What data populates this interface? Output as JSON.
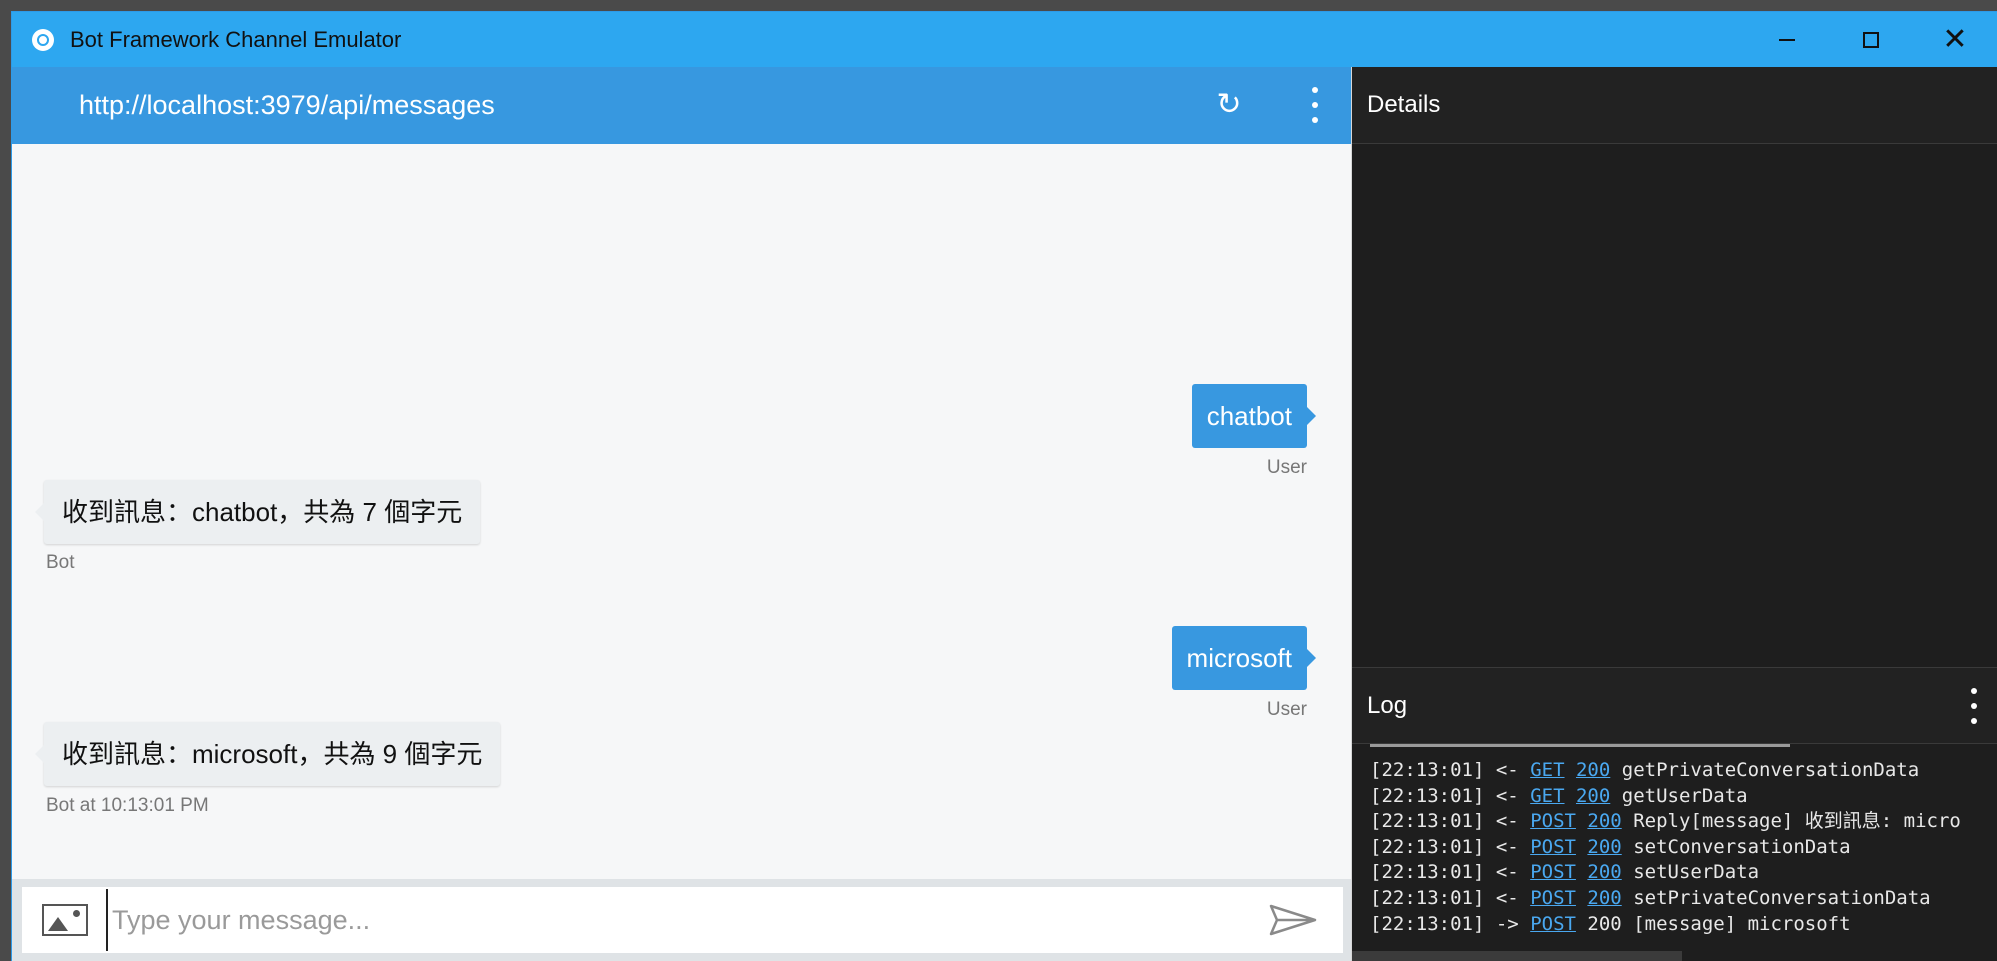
{
  "window": {
    "title": "Bot Framework Channel Emulator"
  },
  "chat": {
    "endpoint_url": "http://localhost:3979/api/messages",
    "messages": [
      {
        "from": "user",
        "text": "chatbot",
        "meta": "User"
      },
      {
        "from": "bot",
        "text": "收到訊息：chatbot，共為 7 個字元",
        "meta": "Bot"
      },
      {
        "from": "user",
        "text": "microsoft",
        "meta": "User"
      },
      {
        "from": "bot",
        "text": "收到訊息：microsoft，共為 9 個字元",
        "meta": "Bot at 10:13:01 PM"
      }
    ],
    "input_placeholder": "Type your message..."
  },
  "details": {
    "title": "Details"
  },
  "log": {
    "title": "Log",
    "lines": [
      {
        "time": "[22:13:01]",
        "dir": "<-",
        "method": "GET",
        "status": "200",
        "text": "getPrivateConversationData",
        "status_link": true
      },
      {
        "time": "[22:13:01]",
        "dir": "<-",
        "method": "GET",
        "status": "200",
        "text": "getUserData",
        "status_link": true
      },
      {
        "time": "[22:13:01]",
        "dir": "<-",
        "method": "POST",
        "status": "200",
        "text": "Reply[message] 收到訊息: micro",
        "status_link": true
      },
      {
        "time": "[22:13:01]",
        "dir": "<-",
        "method": "POST",
        "status": "200",
        "text": "setConversationData",
        "status_link": true
      },
      {
        "time": "[22:13:01]",
        "dir": "<-",
        "method": "POST",
        "status": "200",
        "text": "setUserData",
        "status_link": true
      },
      {
        "time": "[22:13:01]",
        "dir": "<-",
        "method": "POST",
        "status": "200",
        "text": "setPrivateConversationData",
        "status_link": true
      },
      {
        "time": "[22:13:01]",
        "dir": "->",
        "method": "POST",
        "status": "200",
        "text": "[message] microsoft",
        "status_link": false
      }
    ]
  },
  "colors": {
    "titlebar": "#2da7f0",
    "chat_header": "#3798e0",
    "user_bubble": "#3898e0",
    "bot_bubble": "#eceff1",
    "dark_panel": "#1e1e1e",
    "log_link": "#4aa8f0"
  }
}
